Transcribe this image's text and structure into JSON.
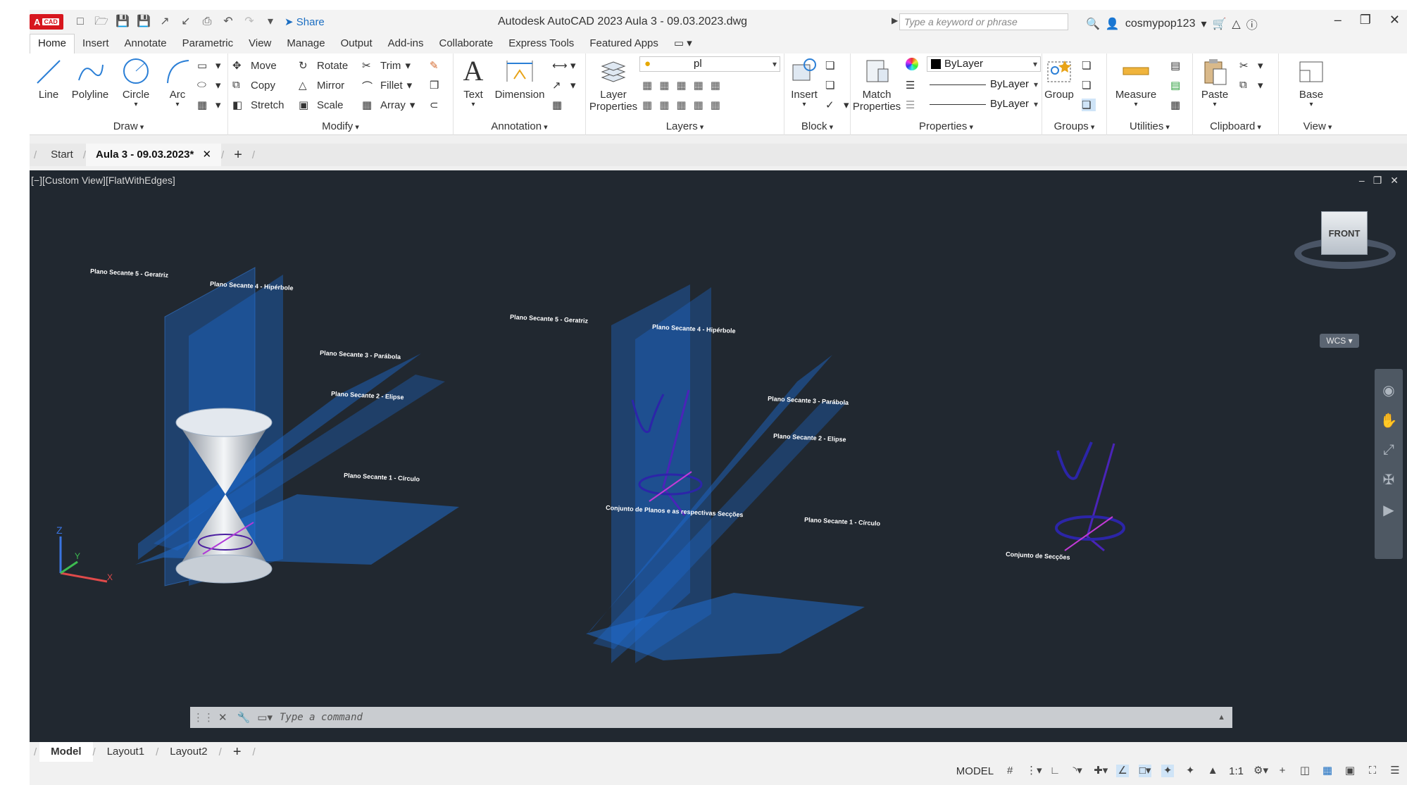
{
  "app": {
    "logo": "A",
    "logo_badge": "CAD",
    "share_label": "Share",
    "title": "Autodesk AutoCAD 2023    Aula 3 - 09.03.2023.dwg",
    "search_placeholder": "Type a keyword or phrase",
    "username": "cosmypop123"
  },
  "ribbon_tabs": [
    "Home",
    "Insert",
    "Annotate",
    "Parametric",
    "View",
    "Manage",
    "Output",
    "Add-ins",
    "Collaborate",
    "Express Tools",
    "Featured Apps"
  ],
  "ribbon": {
    "draw": {
      "title": "Draw",
      "line": "Line",
      "polyline": "Polyline",
      "circle": "Circle",
      "arc": "Arc"
    },
    "modify": {
      "title": "Modify",
      "move": "Move",
      "rotate": "Rotate",
      "trim": "Trim",
      "copy": "Copy",
      "mirror": "Mirror",
      "fillet": "Fillet",
      "stretch": "Stretch",
      "scale": "Scale",
      "array": "Array"
    },
    "annotation": {
      "title": "Annotation",
      "text": "Text",
      "dimension": "Dimension"
    },
    "layers": {
      "title": "Layers",
      "layer_properties_1": "Layer",
      "layer_properties_2": "Properties",
      "current_layer": "pl"
    },
    "block": {
      "title": "Block",
      "insert": "Insert"
    },
    "properties": {
      "title": "Properties",
      "match_1": "Match",
      "match_2": "Properties",
      "color": "ByLayer",
      "lineweight": "ByLayer",
      "linetype": "ByLayer"
    },
    "groups": {
      "title": "Groups",
      "group": "Group"
    },
    "utilities": {
      "title": "Utilities",
      "measure": "Measure"
    },
    "clipboard": {
      "title": "Clipboard",
      "paste": "Paste"
    },
    "view": {
      "title": "View",
      "base": "Base"
    }
  },
  "doc_tabs": {
    "start": "Start",
    "active": "Aula 3 - 09.03.2023*"
  },
  "viewport": {
    "label": "[−][Custom View][FlatWithEdges]",
    "viewcube_face": "FRONT",
    "wcs": "WCS",
    "labels_left": {
      "plano5": "Plano Secante 5 - Geratriz",
      "plano4": "Plano Secante 4 - Hipérbole",
      "plano3": "Plano Secante 3 - Parábola",
      "plano2": "Plano Secante 2 - Elipse",
      "plano1": "Plano Secante 1 - Círculo"
    },
    "labels_middle": {
      "plano5": "Plano Secante 5 - Geratriz",
      "plano4": "Plano Secante 4 - Hipérbole",
      "plano3": "Plano Secante 3 - Parábola",
      "plano2": "Plano Secante 2 - Elipse",
      "plano1": "Plano Secante 1 - Círculo",
      "conjunto": "Conjunto de Planos e as respectivas Secções"
    },
    "label_right": "Conjunto de Secções"
  },
  "command": {
    "placeholder": "Type a command"
  },
  "layout_tabs": [
    "Model",
    "Layout1",
    "Layout2"
  ],
  "status": {
    "model": "MODEL",
    "scale": "1:1"
  }
}
